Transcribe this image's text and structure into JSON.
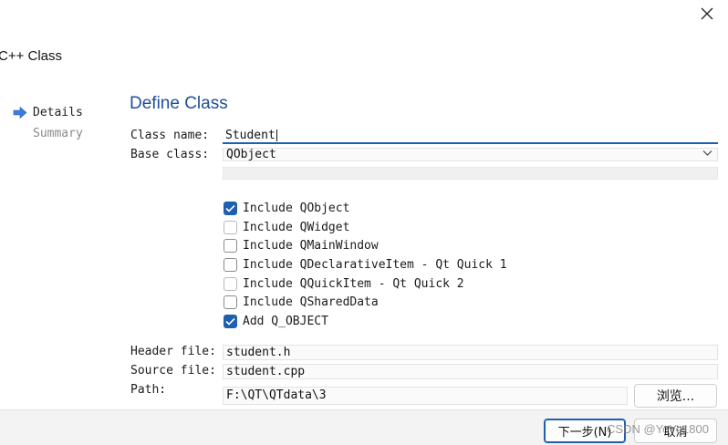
{
  "window": {
    "title": "C++ Class"
  },
  "nav": {
    "items": [
      {
        "label": "Details"
      },
      {
        "label": "Summary"
      }
    ]
  },
  "page": {
    "heading": "Define Class"
  },
  "form": {
    "class_name_label": "Class name:",
    "class_name_value": "Student",
    "base_class_label": "Base class:",
    "base_class_value": "QObject",
    "header_file_label": "Header file:",
    "header_file_value": "student.h",
    "source_file_label": "Source file:",
    "source_file_value": "student.cpp",
    "path_label": "Path:",
    "path_value": "F:\\QT\\QTdata\\3",
    "browse_label": "浏览..."
  },
  "checkboxes": [
    {
      "label": "Include QObject",
      "checked": true
    },
    {
      "label": "Include QWidget",
      "checked": false
    },
    {
      "label": "Include QMainWindow",
      "checked": false
    },
    {
      "label": "Include QDeclarativeItem - Qt Quick 1",
      "checked": false
    },
    {
      "label": "Include QQuickItem - Qt Quick 2",
      "checked": false
    },
    {
      "label": "Include QSharedData",
      "checked": false
    },
    {
      "label": "Add Q_OBJECT",
      "checked": true
    }
  ],
  "footer": {
    "next_label": "下一步(N)",
    "cancel_label": "取消"
  },
  "watermark": "CSDN @YoYo1800",
  "colors": {
    "accent": "#1d5fb0",
    "heading": "#1f4e9a",
    "nav_arrow": "#3b7ddd"
  }
}
